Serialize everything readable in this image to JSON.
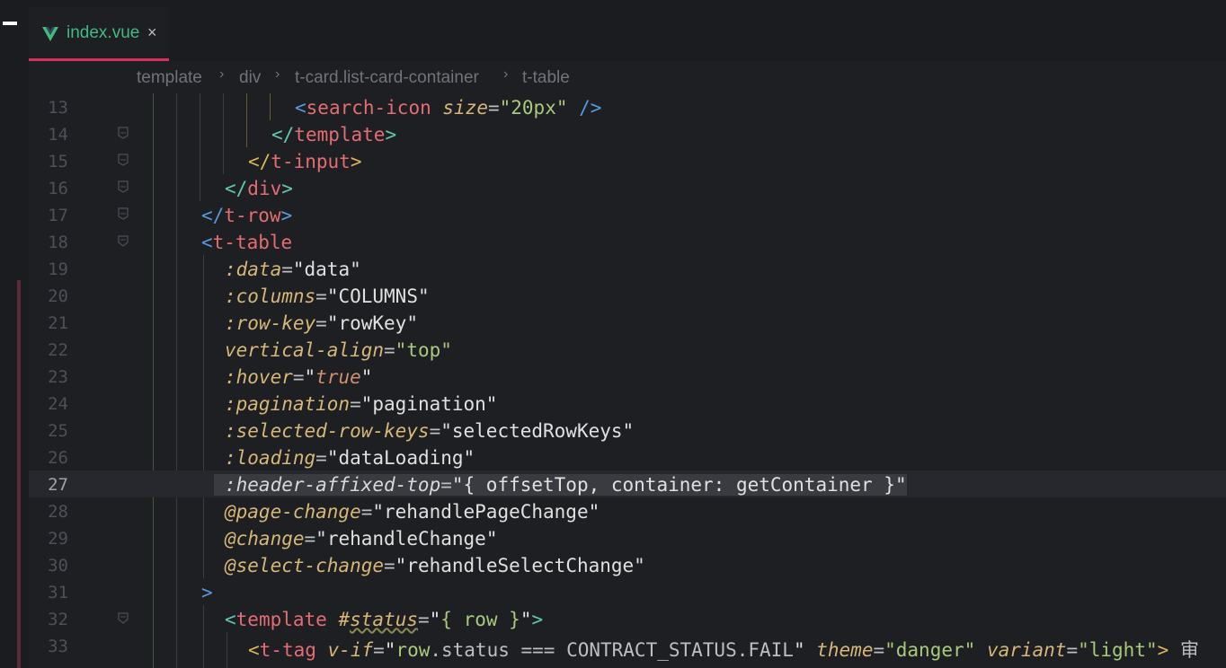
{
  "tab": {
    "label": "index.vue",
    "close": "×",
    "icon": "vue-icon"
  },
  "breadcrumb": [
    "template",
    "div",
    "t-card.list-card-container",
    "t-table"
  ],
  "breadcrumb_sep": "›",
  "current_line": "27",
  "lines": [
    {
      "n": "13",
      "t": "<search-icon size=\"20px\" />"
    },
    {
      "n": "14",
      "t": "</template>"
    },
    {
      "n": "15",
      "t": "</t-input>"
    },
    {
      "n": "16",
      "t": "</div>"
    },
    {
      "n": "17",
      "t": "</t-row>"
    },
    {
      "n": "18",
      "t": "<t-table"
    },
    {
      "n": "19",
      "t": ":data=\"data\""
    },
    {
      "n": "20",
      "t": ":columns=\"COLUMNS\""
    },
    {
      "n": "21",
      "t": ":row-key=\"rowKey\""
    },
    {
      "n": "22",
      "t": "vertical-align=\"top\""
    },
    {
      "n": "23",
      "t": ":hover=\"true\""
    },
    {
      "n": "24",
      "t": ":pagination=\"pagination\""
    },
    {
      "n": "25",
      "t": ":selected-row-keys=\"selectedRowKeys\""
    },
    {
      "n": "26",
      "t": ":loading=\"dataLoading\""
    },
    {
      "n": "27",
      "t": ":header-affixed-top=\"{ offsetTop, container: getContainer }\""
    },
    {
      "n": "28",
      "t": "@page-change=\"rehandlePageChange\""
    },
    {
      "n": "29",
      "t": "@change=\"rehandleChange\""
    },
    {
      "n": "30",
      "t": "@select-change=\"rehandleSelectChange\""
    },
    {
      "n": "31",
      "t": ">"
    },
    {
      "n": "32",
      "t": "<template #status=\"{ row }\">"
    },
    {
      "n": "33",
      "t": "<t-tag v-if=\"row.status === CONTRACT_STATUS.FAIL\" theme=\"danger\" variant=\"light\"> 审"
    }
  ],
  "colors": {
    "accent": "#d9305c",
    "vue_green": "#42b883",
    "background": "#1e1f22"
  }
}
